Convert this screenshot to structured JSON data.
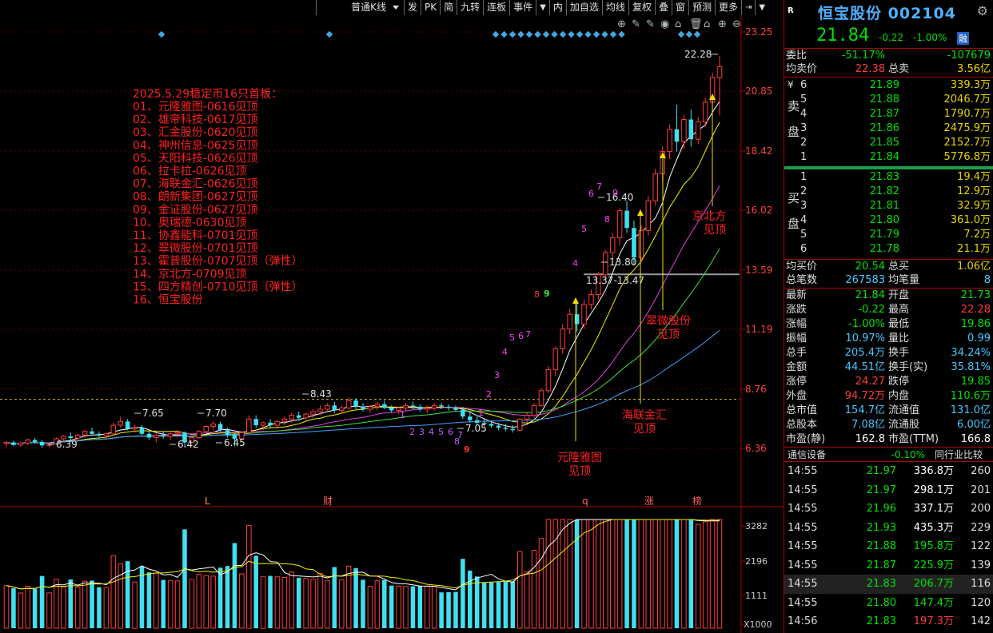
{
  "toolbar": {
    "items": [
      "普通K线",
      "发",
      "PK",
      "简",
      "九转",
      "连板",
      "事件",
      "内",
      "加自选",
      "均线",
      "复权",
      "叠",
      "窗",
      "预测",
      "更多"
    ]
  },
  "icons": {
    "chart_tools": [
      "target-icon",
      "pen-icon",
      "pen-icon",
      "eye-icon",
      "lock-icon",
      "trash-icon",
      "lock-icon",
      "zoom-in-icon",
      "zoom-out-icon"
    ],
    "gear": "gear-icon"
  },
  "colors": {
    "up": "#ff3b3b",
    "down": "#40e0f0",
    "ma5": "#ffffff",
    "ma10": "#f0f000",
    "ma20": "#e040e0",
    "ma30": "#40e040",
    "ma60": "#40a0ff",
    "annotation": "#ff2020"
  },
  "chart": {
    "y_ticks": [
      "23.25",
      "20.85",
      "18.42",
      "16.02",
      "13.59",
      "11.19",
      "8.76",
      "6.36"
    ],
    "vol_ticks": [
      "3282",
      "2196",
      "1111",
      "X1000"
    ],
    "high_label": "22.28",
    "price_labels": [
      "7.65",
      "7.70",
      "8.43",
      "6.39",
      "6.42",
      "6.45",
      "7.05",
      "16.40",
      "13.80",
      "13.37-13.47"
    ],
    "event_markers": [
      "L",
      "财",
      "q",
      "涨",
      "榜"
    ],
    "annotation_title": "2025.5.29稳定币16只首板：",
    "annotation_lines": [
      "01、元隆雅图-0616见顶",
      "02、雄帝科技-0617见顶",
      "03、汇金股份-0620见顶",
      "04、神州信息-0625见顶",
      "05、天阳科技-0626见顶",
      "06、拉卡拉-0626见顶",
      "07、海联金汇-0626见顶",
      "08、朗新集团-0627见顶",
      "09、金证股份-0627见顶",
      "10、奥瑞德-0630见顶",
      "11、协鑫能科-0701见顶",
      "12、翠微股份-0701见顶",
      "13、霍普股份-0707见顶（弹性）",
      "14、京北方-0709见顶",
      "15、四方精创-0710见顶（弹性）",
      "16、恒宝股份"
    ],
    "arrow_labels": [
      {
        "l1": "元隆雅图",
        "l2": "见顶"
      },
      {
        "l1": "海联金汇",
        "l2": "见顶"
      },
      {
        "l1": "翠微股份",
        "l2": "见顶"
      },
      {
        "l1": "京北方",
        "l2": "见顶"
      }
    ],
    "td_down_counts": [
      "1",
      "2",
      "3",
      "4",
      "5",
      "6",
      "7",
      "8",
      "9"
    ],
    "td_up_counts": [
      "1",
      "2",
      "3",
      "4",
      "5",
      "6",
      "7",
      "8",
      "9",
      "4",
      "5",
      "6",
      "7",
      "8",
      "9"
    ]
  },
  "panel": {
    "badge": "R",
    "name": "恒宝股份",
    "code": "002104",
    "price": "21.84",
    "change": "-0.22",
    "change_pct": "-1.00%",
    "exchange": "融",
    "weibi": {
      "label": "委比",
      "value": "-51.17%",
      "diff": "-107679"
    },
    "avg_sell": {
      "label": "均卖价",
      "value": "22.38",
      "label2": "总卖",
      "value2": "3.56亿"
    },
    "sell_side": "卖盘",
    "buy_side": "买盘",
    "currency": "¥",
    "sells": [
      {
        "lv": "6",
        "px": "21.89",
        "qty": "339.3万"
      },
      {
        "lv": "5",
        "px": "21.88",
        "qty": "2046.7万"
      },
      {
        "lv": "4",
        "px": "21.87",
        "qty": "1790.7万"
      },
      {
        "lv": "3",
        "px": "21.86",
        "qty": "2475.9万"
      },
      {
        "lv": "2",
        "px": "21.85",
        "qty": "2152.7万"
      },
      {
        "lv": "1",
        "px": "21.84",
        "qty": "5776.8万"
      }
    ],
    "buys": [
      {
        "lv": "1",
        "px": "21.83",
        "qty": "19.4万"
      },
      {
        "lv": "2",
        "px": "21.82",
        "qty": "12.9万"
      },
      {
        "lv": "3",
        "px": "21.81",
        "qty": "32.9万"
      },
      {
        "lv": "4",
        "px": "21.80",
        "qty": "361.0万"
      },
      {
        "lv": "5",
        "px": "21.79",
        "qty": "7.2万"
      },
      {
        "lv": "6",
        "px": "21.78",
        "qty": "21.1万"
      }
    ],
    "avg_buy": {
      "label": "均买价",
      "value": "20.54",
      "label2": "总买",
      "value2": "1.06亿"
    },
    "trades": {
      "label": "总笔数",
      "value": "267583",
      "label2": "均笔量",
      "value2": "8"
    },
    "stats": [
      {
        "l1": "最新",
        "v1": "21.84",
        "c1": "grn",
        "l2": "开盘",
        "v2": "21.73",
        "c2": "grn"
      },
      {
        "l1": "涨跌",
        "v1": "-0.22",
        "c1": "grn",
        "l2": "最高",
        "v2": "22.28",
        "c2": "red"
      },
      {
        "l1": "涨幅",
        "v1": "-1.00%",
        "c1": "grn",
        "l2": "最低",
        "v2": "19.86",
        "c2": "grn"
      },
      {
        "l1": "振幅",
        "v1": "10.97%",
        "c1": "cyn",
        "l2": "量比",
        "v2": "0.99",
        "c2": "cyn"
      },
      {
        "l1": "总手",
        "v1": "205.4万",
        "c1": "cyn",
        "l2": "换手",
        "v2": "34.24%",
        "c2": "cyn"
      },
      {
        "l1": "金额",
        "v1": "44.51亿",
        "c1": "cyn",
        "l2": "换手(实)",
        "v2": "35.81%",
        "c2": "cyn"
      },
      {
        "l1": "涨停",
        "v1": "24.27",
        "c1": "red",
        "l2": "跌停",
        "v2": "19.85",
        "c2": "grn"
      },
      {
        "l1": "外盘",
        "v1": "94.72万",
        "c1": "red",
        "l2": "内盘",
        "v2": "110.6万",
        "c2": "grn"
      },
      {
        "l1": "总市值",
        "v1": "154.7亿",
        "c1": "cyn",
        "l2": "流通值",
        "v2": "131.0亿",
        "c2": "cyn"
      },
      {
        "l1": "总股本",
        "v1": "7.08亿",
        "c1": "cyn",
        "l2": "流通股",
        "v2": "6.00亿",
        "c2": "cyn"
      },
      {
        "l1": "市盈(静)",
        "v1": "162.8",
        "c1": "wht",
        "l2": "市盈(TTM)",
        "v2": "166.8",
        "c2": "wht"
      }
    ],
    "sector": {
      "name": "通信设备",
      "change": "-0.10%",
      "compare": "同行业比较"
    },
    "ticks": [
      {
        "t": "14:55",
        "p": "21.97",
        "v": "336.8万",
        "vc": "wht",
        "n": "260"
      },
      {
        "t": "14:55",
        "p": "21.97",
        "v": "298.1万",
        "vc": "wht",
        "n": "201"
      },
      {
        "t": "14:55",
        "p": "21.96",
        "v": "337.1万",
        "vc": "wht",
        "n": "200"
      },
      {
        "t": "14:55",
        "p": "21.93",
        "v": "435.3万",
        "vc": "wht",
        "n": "229"
      },
      {
        "t": "14:55",
        "p": "21.88",
        "v": "195.8万",
        "vc": "grn",
        "n": "122"
      },
      {
        "t": "14:55",
        "p": "21.87",
        "v": "225.9万",
        "vc": "grn",
        "n": "139"
      },
      {
        "t": "14:55",
        "p": "21.83",
        "v": "206.7万",
        "vc": "grn",
        "n": "116"
      },
      {
        "t": "14:55",
        "p": "21.80",
        "v": "147.4万",
        "vc": "grn",
        "n": "120"
      },
      {
        "t": "14:56",
        "p": "21.83",
        "v": "197.3万",
        "vc": "red",
        "n": "142"
      }
    ]
  },
  "chart_data": {
    "type": "candlestick",
    "ylim": [
      6.36,
      23.25
    ],
    "y_ticks": [
      23.25,
      20.85,
      18.42,
      16.02,
      13.59,
      11.19,
      8.76,
      6.36
    ],
    "volume_ticks": [
      3282,
      2196,
      1111
    ],
    "volume_unit": "X1000",
    "candles": [
      [
        6.55,
        6.65,
        6.4,
        6.6
      ],
      [
        6.6,
        6.68,
        6.45,
        6.5
      ],
      [
        6.5,
        6.62,
        6.42,
        6.58
      ],
      [
        6.58,
        6.75,
        6.5,
        6.7
      ],
      [
        6.7,
        6.78,
        6.55,
        6.62
      ],
      [
        6.62,
        6.7,
        6.39,
        6.48
      ],
      [
        6.48,
        6.6,
        6.4,
        6.55
      ],
      [
        6.55,
        6.8,
        6.5,
        6.75
      ],
      [
        6.75,
        6.9,
        6.65,
        6.85
      ],
      [
        6.85,
        7.0,
        6.7,
        6.78
      ],
      [
        6.78,
        6.95,
        6.7,
        6.9
      ],
      [
        6.9,
        7.1,
        6.8,
        7.05
      ],
      [
        7.05,
        7.2,
        6.9,
        6.95
      ],
      [
        6.95,
        7.05,
        6.8,
        6.88
      ],
      [
        6.88,
        7.0,
        6.75,
        6.95
      ],
      [
        6.95,
        7.4,
        6.9,
        7.3
      ],
      [
        7.3,
        7.65,
        7.2,
        7.45
      ],
      [
        7.45,
        7.55,
        7.1,
        7.15
      ],
      [
        7.15,
        7.3,
        7.0,
        7.2
      ],
      [
        7.2,
        7.3,
        6.9,
        6.95
      ],
      [
        6.95,
        7.05,
        6.7,
        6.8
      ],
      [
        6.8,
        6.95,
        6.6,
        6.9
      ],
      [
        6.9,
        7.05,
        6.75,
        6.85
      ],
      [
        6.85,
        7.0,
        6.7,
        6.95
      ],
      [
        6.95,
        7.1,
        6.8,
        7.0
      ],
      [
        7.0,
        7.05,
        6.42,
        6.6
      ],
      [
        6.6,
        6.85,
        6.55,
        6.8
      ],
      [
        6.8,
        7.1,
        6.75,
        7.05
      ],
      [
        7.05,
        7.3,
        6.95,
        7.25
      ],
      [
        7.25,
        7.45,
        7.1,
        7.35
      ],
      [
        7.35,
        7.45,
        7.05,
        7.1
      ],
      [
        7.1,
        7.2,
        6.8,
        6.9
      ],
      [
        6.9,
        7.0,
        6.45,
        6.75
      ],
      [
        6.75,
        7.05,
        6.7,
        7.0
      ],
      [
        7.0,
        7.7,
        6.95,
        7.55
      ],
      [
        7.55,
        7.7,
        7.2,
        7.3
      ],
      [
        7.3,
        7.45,
        7.1,
        7.4
      ],
      [
        7.4,
        7.55,
        7.2,
        7.3
      ],
      [
        7.3,
        7.5,
        7.15,
        7.45
      ],
      [
        7.45,
        7.65,
        7.3,
        7.55
      ],
      [
        7.55,
        7.8,
        7.4,
        7.7
      ],
      [
        7.7,
        7.85,
        7.5,
        7.6
      ],
      [
        7.6,
        7.8,
        7.45,
        7.75
      ],
      [
        7.75,
        7.95,
        7.6,
        7.85
      ],
      [
        7.85,
        8.1,
        7.7,
        7.95
      ],
      [
        7.95,
        8.2,
        7.85,
        8.1
      ],
      [
        8.1,
        8.25,
        7.8,
        7.9
      ],
      [
        7.9,
        8.1,
        7.75,
        8.0
      ],
      [
        8.0,
        8.43,
        7.95,
        8.3
      ],
      [
        8.3,
        8.4,
        7.95,
        8.05
      ],
      [
        8.05,
        8.2,
        7.85,
        7.95
      ],
      [
        7.95,
        8.1,
        7.8,
        8.05
      ],
      [
        8.05,
        8.25,
        7.9,
        8.15
      ],
      [
        8.15,
        8.3,
        7.95,
        8.0
      ],
      [
        8.0,
        8.1,
        7.8,
        7.9
      ],
      [
        7.9,
        8.05,
        7.75,
        8.0
      ],
      [
        8.0,
        8.2,
        7.9,
        8.1
      ],
      [
        8.1,
        8.25,
        7.95,
        8.05
      ],
      [
        8.05,
        8.15,
        7.85,
        7.95
      ],
      [
        7.95,
        8.1,
        7.8,
        8.0
      ],
      [
        8.0,
        8.2,
        7.9,
        8.1
      ],
      [
        8.1,
        8.2,
        7.95,
        8.05
      ],
      [
        8.05,
        8.15,
        7.9,
        8.0
      ],
      [
        8.0,
        8.1,
        7.85,
        7.92
      ],
      [
        7.92,
        8.05,
        7.55,
        7.65
      ],
      [
        7.65,
        7.8,
        7.4,
        7.5
      ],
      [
        7.5,
        7.65,
        7.3,
        7.4
      ],
      [
        7.4,
        7.55,
        7.25,
        7.35
      ],
      [
        7.35,
        7.5,
        7.2,
        7.28
      ],
      [
        7.28,
        7.4,
        7.1,
        7.2
      ],
      [
        7.2,
        7.35,
        7.05,
        7.15
      ],
      [
        7.15,
        7.3,
        7.0,
        7.1
      ],
      [
        7.1,
        7.6,
        7.05,
        7.55
      ],
      [
        7.55,
        7.8,
        7.4,
        7.7
      ],
      [
        7.7,
        8.2,
        7.6,
        8.1
      ],
      [
        8.1,
        8.8,
        8.05,
        8.7
      ],
      [
        8.7,
        9.7,
        8.6,
        9.55
      ],
      [
        9.55,
        10.5,
        9.3,
        10.4
      ],
      [
        10.4,
        11.4,
        10.2,
        11.2
      ],
      [
        11.2,
        12.0,
        11.0,
        11.8
      ],
      [
        11.8,
        12.3,
        11.1,
        11.4
      ],
      [
        11.4,
        12.4,
        11.2,
        12.2
      ],
      [
        12.2,
        12.8,
        12.0,
        12.6
      ],
      [
        12.6,
        13.5,
        12.4,
        13.4
      ],
      [
        13.4,
        14.4,
        13.2,
        14.3
      ],
      [
        14.3,
        15.1,
        13.9,
        14.9
      ],
      [
        14.9,
        16.1,
        14.6,
        16.0
      ],
      [
        16.0,
        16.4,
        15.1,
        15.3
      ],
      [
        15.3,
        15.6,
        13.8,
        14.1
      ],
      [
        14.1,
        15.4,
        13.9,
        15.2
      ],
      [
        15.2,
        16.6,
        15.0,
        16.4
      ],
      [
        16.4,
        17.7,
        16.2,
        17.5
      ],
      [
        17.5,
        18.6,
        17.2,
        18.4
      ],
      [
        18.4,
        19.5,
        18.1,
        19.3
      ],
      [
        19.3,
        20.3,
        18.4,
        18.8
      ],
      [
        18.8,
        19.9,
        18.5,
        19.7
      ],
      [
        19.7,
        20.1,
        18.6,
        18.9
      ],
      [
        18.9,
        19.8,
        18.7,
        19.6
      ],
      [
        19.6,
        20.6,
        19.4,
        20.4
      ],
      [
        20.4,
        21.6,
        20.2,
        21.4
      ],
      [
        21.4,
        22.28,
        19.86,
        21.84
      ]
    ]
  }
}
